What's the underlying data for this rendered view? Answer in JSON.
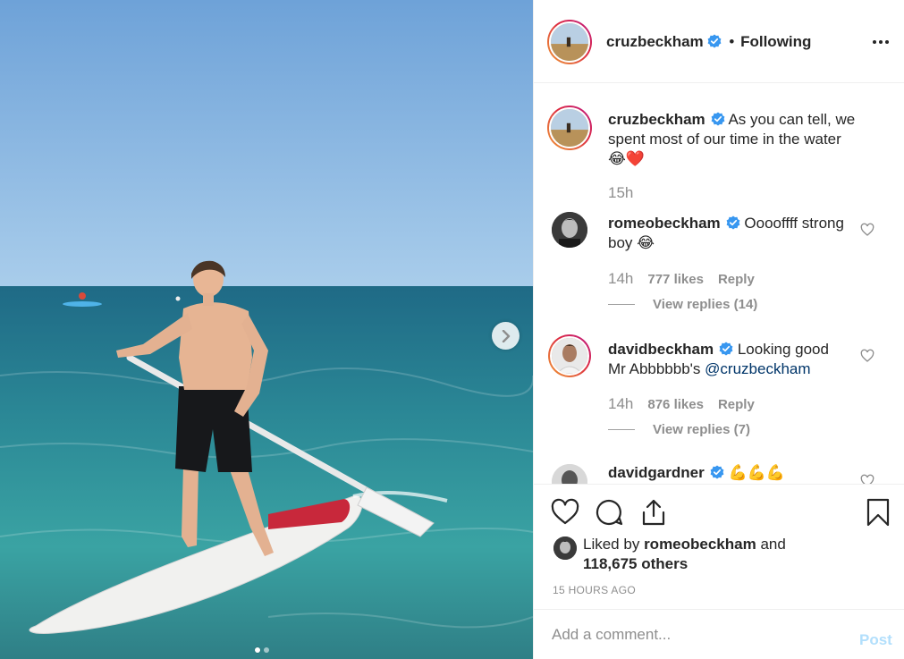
{
  "post": {
    "author": "cruzbeckham",
    "follow_separator": "•",
    "follow_status": "Following",
    "media_dots": 2,
    "active_dot": 0
  },
  "caption": {
    "username": "cruzbeckham",
    "text": "As you can tell, we spent most of our time in the water",
    "emojis": "😂❤️",
    "timestamp": "15h"
  },
  "comments": [
    {
      "username": "romeobeckham",
      "text": "Ooooffff strong boy",
      "emoji": "😂",
      "timestamp": "14h",
      "likes": "777 likes",
      "reply": "Reply",
      "view_replies": "View replies (14)"
    },
    {
      "username": "davidbeckham",
      "text": "Looking good Mr Abbbbbb's",
      "mention": "@cruzbeckham",
      "timestamp": "14h",
      "likes": "876 likes",
      "reply": "Reply",
      "view_replies": "View replies (7)"
    },
    {
      "username": "davidgardner",
      "text": "💪💪💪"
    }
  ],
  "likes": {
    "prefix": "Liked by",
    "user": "romeobeckham",
    "connector": "and",
    "others": "118,675 others"
  },
  "post_time": "15 HOURS AGO",
  "add_comment": {
    "placeholder": "Add a comment...",
    "post_label": "Post"
  },
  "colors": {
    "verified": "#3897f0",
    "post_button_disabled": "#b2dffc",
    "secondary_text": "#8e8e8e",
    "mention": "#003569"
  },
  "icons": [
    "verified-icon",
    "more-options-icon",
    "next-arrow-icon",
    "heart-icon",
    "comment-icon",
    "share-icon",
    "bookmark-icon"
  ]
}
